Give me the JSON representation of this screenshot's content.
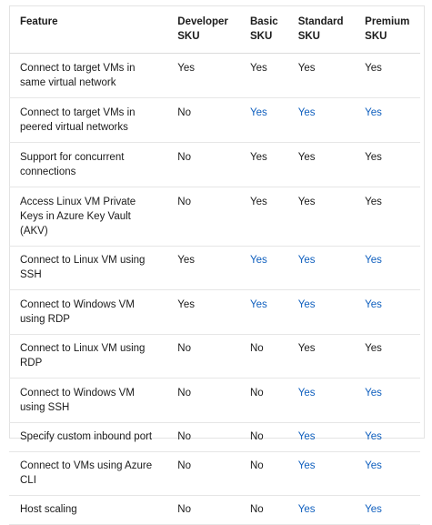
{
  "table": {
    "headers": [
      "Feature",
      "Developer SKU",
      "Basic SKU",
      "Standard SKU",
      "Premium SKU"
    ],
    "header_lines": [
      [
        "Feature",
        ""
      ],
      [
        "Developer",
        "SKU"
      ],
      [
        "Basic",
        "SKU"
      ],
      [
        "Standard",
        "SKU"
      ],
      [
        "Premium",
        "SKU"
      ]
    ],
    "rows": [
      {
        "feature": "Connect to target VMs in same virtual network",
        "values": [
          "Yes",
          "Yes",
          "Yes",
          "Yes"
        ],
        "link": [
          false,
          false,
          false,
          false
        ]
      },
      {
        "feature": "Connect to target VMs in peered virtual networks",
        "values": [
          "No",
          "Yes",
          "Yes",
          "Yes"
        ],
        "link": [
          false,
          true,
          true,
          true
        ]
      },
      {
        "feature": "Support for concurrent connections",
        "values": [
          "No",
          "Yes",
          "Yes",
          "Yes"
        ],
        "link": [
          false,
          false,
          false,
          false
        ]
      },
      {
        "feature": "Access Linux VM Private Keys in Azure Key Vault (AKV)",
        "values": [
          "No",
          "Yes",
          "Yes",
          "Yes"
        ],
        "link": [
          false,
          false,
          false,
          false
        ]
      },
      {
        "feature": "Connect to Linux VM using SSH",
        "values": [
          "Yes",
          "Yes",
          "Yes",
          "Yes"
        ],
        "link": [
          false,
          true,
          true,
          true
        ]
      },
      {
        "feature": "Connect to Windows VM using RDP",
        "values": [
          "Yes",
          "Yes",
          "Yes",
          "Yes"
        ],
        "link": [
          false,
          true,
          true,
          true
        ]
      },
      {
        "feature": "Connect to Linux VM using RDP",
        "values": [
          "No",
          "No",
          "Yes",
          "Yes"
        ],
        "link": [
          false,
          false,
          false,
          false
        ]
      },
      {
        "feature": "Connect to Windows VM using SSH",
        "values": [
          "No",
          "No",
          "Yes",
          "Yes"
        ],
        "link": [
          false,
          false,
          true,
          true
        ]
      },
      {
        "feature": "Specify custom inbound port",
        "values": [
          "No",
          "No",
          "Yes",
          "Yes"
        ],
        "link": [
          false,
          false,
          true,
          true
        ]
      },
      {
        "feature": "Connect to VMs using Azure CLI",
        "values": [
          "No",
          "No",
          "Yes",
          "Yes"
        ],
        "link": [
          false,
          false,
          true,
          true
        ]
      },
      {
        "feature": "Host scaling",
        "values": [
          "No",
          "No",
          "Yes",
          "Yes"
        ],
        "link": [
          false,
          false,
          true,
          true
        ]
      }
    ]
  },
  "colors": {
    "link_blue": "#0f5fbe",
    "text": "#1b1b1b",
    "border": "#e6e6e6"
  }
}
